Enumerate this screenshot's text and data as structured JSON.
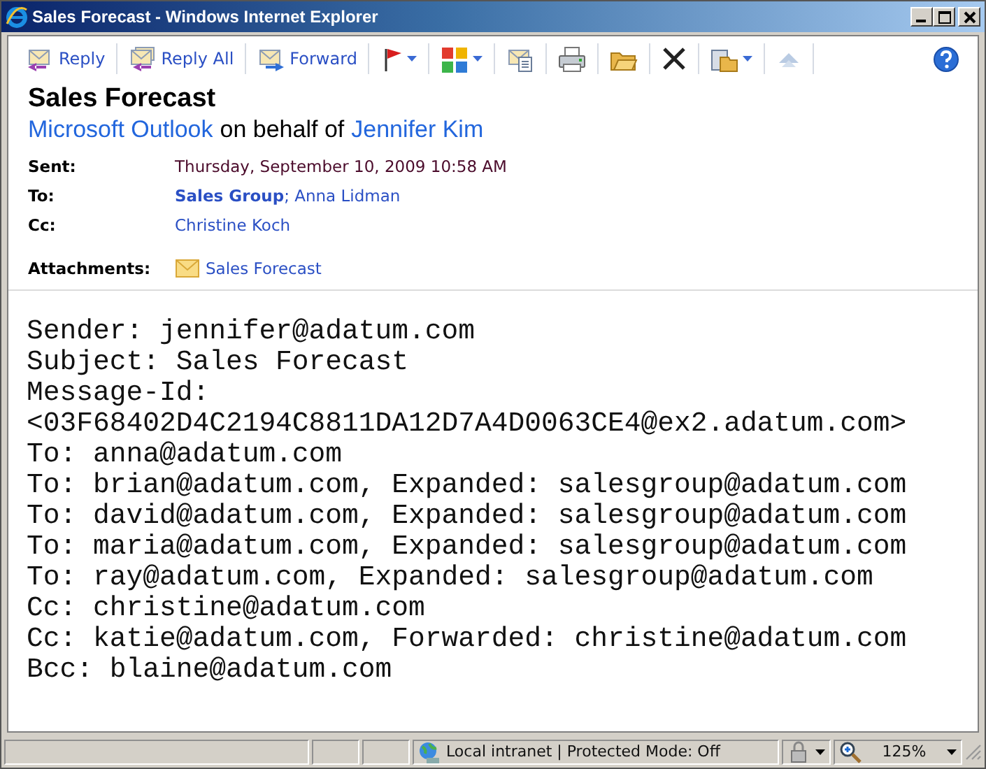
{
  "window": {
    "title": "Sales Forecast - Windows Internet Explorer"
  },
  "toolbar": [
    {
      "label": "Reply"
    },
    {
      "label": "Reply All"
    },
    {
      "label": "Forward"
    }
  ],
  "message": {
    "subject": "Sales Forecast",
    "from": {
      "sender": "Microsoft Outlook",
      "connector": "on behalf of",
      "on_behalf_of": "Jennifer Kim"
    },
    "fields": [
      {
        "label": "Sent:",
        "value": "Thursday, September 10, 2009 10:58 AM",
        "kind": "text"
      },
      {
        "label": "To:",
        "value": "**Sales Group**; Anna Lidman",
        "kind": "link"
      },
      {
        "label": "Cc:",
        "value": "Christine Koch",
        "kind": "link"
      },
      {
        "label": "Attachments:",
        "value": "Sales Forecast",
        "kind": "attachment"
      }
    ],
    "body_lines": [
      "Sender: jennifer@adatum.com",
      "Subject: Sales Forecast",
      "Message-Id:",
      "<03F68402D4C2194C8811DA12D7A4D0063CE4@ex2.adatum.com>",
      "To: anna@adatum.com",
      "To: brian@adatum.com, Expanded: salesgroup@adatum.com",
      "To: david@adatum.com, Expanded: salesgroup@adatum.com",
      "To: maria@adatum.com, Expanded: salesgroup@adatum.com",
      "To: ray@adatum.com, Expanded: salesgroup@adatum.com",
      "Cc: christine@adatum.com",
      "Cc: katie@adatum.com, Forwarded: christine@adatum.com",
      "Bcc: blaine@adatum.com"
    ]
  },
  "status_bar": {
    "zone": "Local intranet | Protected Mode: Off",
    "zoom": "125%"
  }
}
